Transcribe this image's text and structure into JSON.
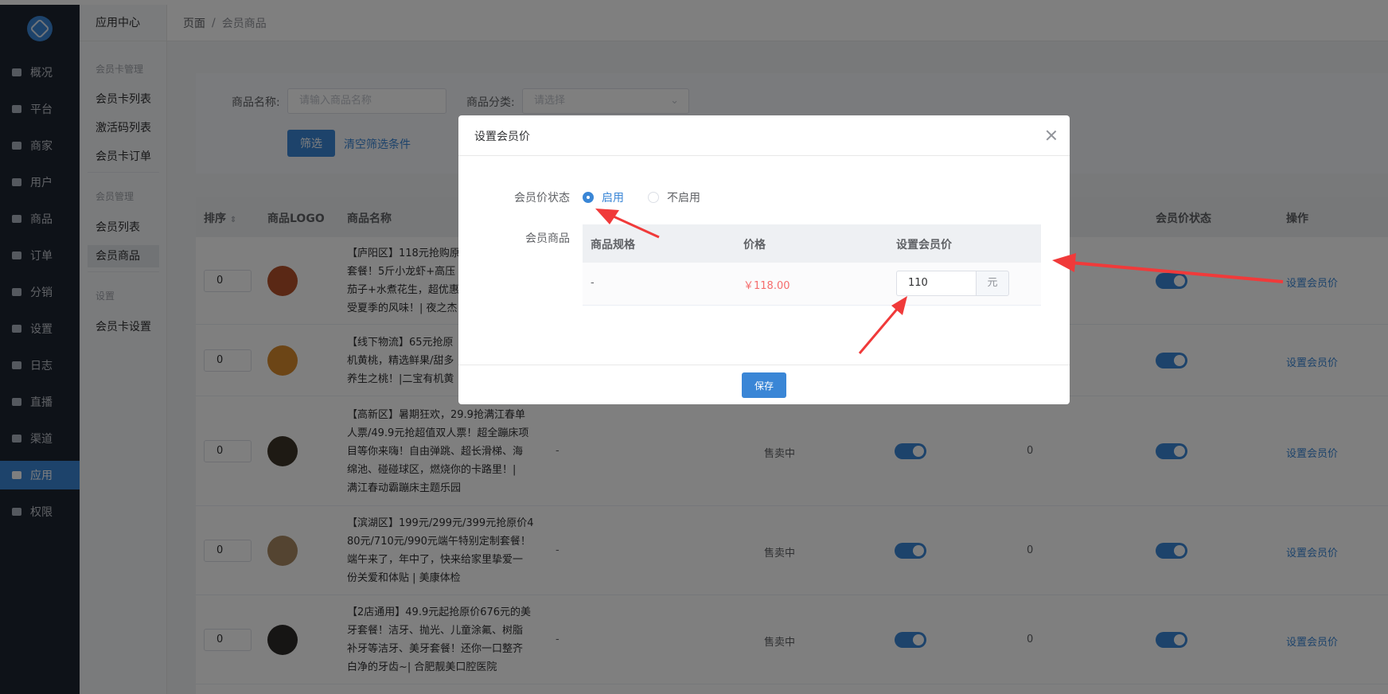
{
  "sidebar": {
    "items": [
      {
        "label": "概况",
        "icon": "dashboard-icon"
      },
      {
        "label": "平台",
        "icon": "monitor-icon"
      },
      {
        "label": "商家",
        "icon": "store-icon"
      },
      {
        "label": "用户",
        "icon": "user-icon"
      },
      {
        "label": "商品",
        "icon": "goods-icon"
      },
      {
        "label": "订单",
        "icon": "order-icon"
      },
      {
        "label": "分销",
        "icon": "distribution-icon"
      },
      {
        "label": "设置",
        "icon": "gear-icon"
      },
      {
        "label": "日志",
        "icon": "log-icon"
      },
      {
        "label": "直播",
        "icon": "live-icon"
      },
      {
        "label": "渠道",
        "icon": "channel-icon"
      },
      {
        "label": "应用",
        "icon": "apps-icon"
      },
      {
        "label": "权限",
        "icon": "lock-icon"
      }
    ],
    "active_index": 11
  },
  "submenu": {
    "title": "应用中心",
    "groups": [
      {
        "label": "会员卡管理",
        "items": [
          "会员卡列表",
          "激活码列表",
          "会员卡订单"
        ]
      },
      {
        "label": "会员管理",
        "items": [
          "会员列表",
          "会员商品"
        ]
      },
      {
        "label": "设置",
        "items": [
          "会员卡设置"
        ]
      }
    ],
    "active_item": "会员商品"
  },
  "breadcrumb": {
    "root": "页面",
    "separator": "/",
    "current": "会员商品"
  },
  "filter": {
    "name_label": "商品名称:",
    "name_placeholder": "请输入商品名称",
    "category_label": "商品分类:",
    "category_placeholder": "请选择",
    "filter_button": "筛选",
    "clear_link": "清空筛选条件"
  },
  "table": {
    "headers": {
      "sort": "排序",
      "logo": "商品LOGO",
      "name": "商品名称",
      "member_status": "会员价状态",
      "action": "操作"
    },
    "rows": [
      {
        "sort": "0",
        "name": "【庐阳区】118元抢购原价...\n套餐！5斤小龙虾+高压...\n茄子+水煮花生，超优惠...\n受夏季的风味！| 夜之...",
        "name_lines": [
          "【庐阳区】118元抢购原",
          "套餐！5斤小龙虾+高压",
          "茄子+水煮花生，超优惠",
          "受夏季的风味！| 夜之杰"
        ],
        "spec": "",
        "status": "",
        "count": "",
        "op": "设置会员价"
      },
      {
        "sort": "0",
        "name_lines": [
          "【线下物流】65元抢原",
          "机黄桃，精选鲜果/甜多",
          "养生之桃！|二宝有机黄"
        ],
        "spec": "",
        "status": "",
        "count": "",
        "op": "设置会员价"
      },
      {
        "sort": "0",
        "name_lines": [
          "【高新区】暑期狂欢，29.9抢满江春单",
          "人票/49.9元抢超值双人票！超全蹦床项",
          "目等你来嗨！自由弹跳、超长滑梯、海",
          "绵池、碰碰球区，燃烧你的卡路里！|",
          "满江春动霸蹦床主题乐园"
        ],
        "spec": "-",
        "status": "售卖中",
        "count": "0",
        "op": "设置会员价"
      },
      {
        "sort": "0",
        "name_lines": [
          "【滨湖区】199元/299元/399元抢原价4",
          "80元/710元/990元端午特别定制套餐！",
          "端午来了，年中了，快来给家里挚爱一",
          "份关爱和体贴 | 美康体检"
        ],
        "spec": "-",
        "status": "售卖中",
        "count": "0",
        "op": "设置会员价"
      },
      {
        "sort": "0",
        "name_lines": [
          "【2店通用】49.9元起抢原价676元的美",
          "牙套餐！洁牙、抛光、儿童涂氟、树脂",
          "补牙等洁牙、美牙套餐！还你一口整齐",
          "白净的牙齿~| 合肥靓美口腔医院"
        ],
        "spec": "-",
        "status": "售卖中",
        "count": "0",
        "op": "设置会员价"
      }
    ]
  },
  "dialog": {
    "title": "设置会员价",
    "status_label": "会员价状态",
    "enable_label": "启用",
    "disable_label": "不启用",
    "selected": "启用",
    "goods_label": "会员商品",
    "inner_headers": {
      "spec": "商品规格",
      "price": "价格",
      "member_price": "设置会员价"
    },
    "inner_row": {
      "spec": "-",
      "price": "￥118.00",
      "member_price": "110",
      "unit": "元"
    },
    "save_button": "保存"
  },
  "colors": {
    "accent": "#3a86d6",
    "sidebar": "#1d2531",
    "price": "#f56c6c",
    "arrow": "#f03a3a"
  }
}
